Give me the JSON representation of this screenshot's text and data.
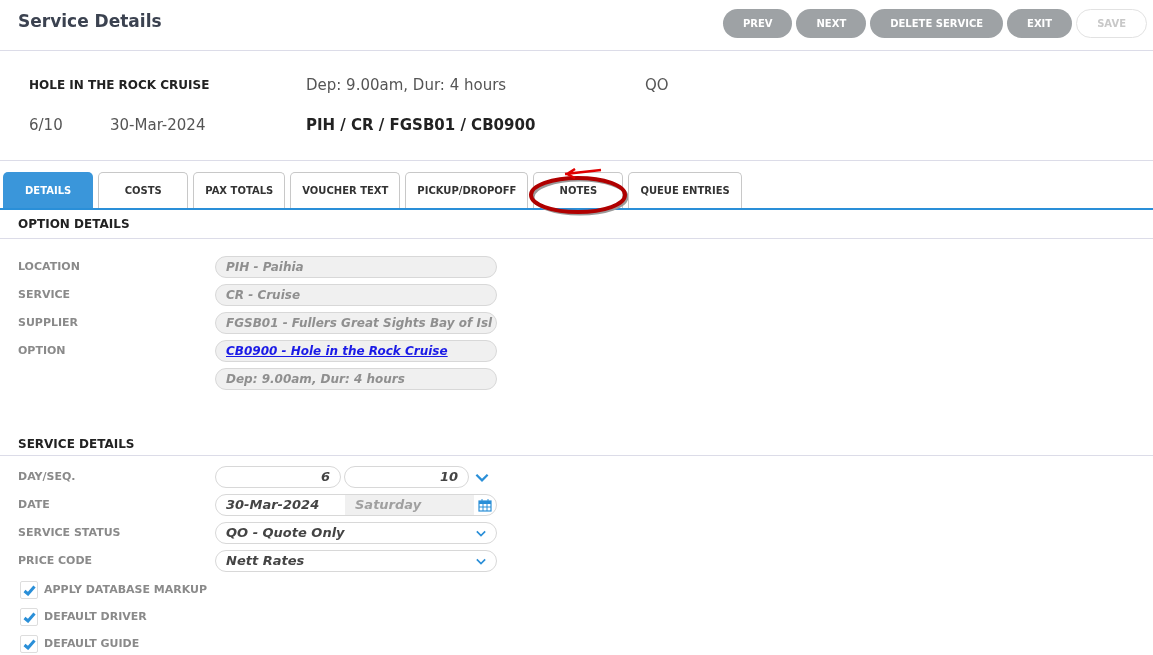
{
  "header": {
    "title": "Service Details",
    "buttons": [
      {
        "label": "PREV",
        "disabled": false
      },
      {
        "label": "NEXT",
        "disabled": false
      },
      {
        "label": "DELETE SERVICE",
        "disabled": false
      },
      {
        "label": "EXIT",
        "disabled": false
      },
      {
        "label": "SAVE",
        "disabled": true
      }
    ]
  },
  "summary": {
    "name": "HOLE IN THE ROCK CRUISE",
    "departure": "Dep: 9.00am, Dur: 4 hours",
    "status": "QO",
    "day_seq": "6/10",
    "date": "30-Mar-2024",
    "codes": "PIH / CR / FGSB01 / CB0900"
  },
  "tabs": [
    {
      "label": "DETAILS",
      "selected": true,
      "highlighted": false
    },
    {
      "label": "COSTS",
      "selected": false,
      "highlighted": false
    },
    {
      "label": "PAX TOTALS",
      "selected": false,
      "highlighted": false
    },
    {
      "label": "VOUCHER TEXT",
      "selected": false,
      "highlighted": false
    },
    {
      "label": "PICKUP/DROPOFF",
      "selected": false,
      "highlighted": false
    },
    {
      "label": "NOTES",
      "selected": false,
      "highlighted": true
    },
    {
      "label": "QUEUE ENTRIES",
      "selected": false,
      "highlighted": false
    }
  ],
  "option_details": {
    "heading": "OPTION DETAILS",
    "fields": [
      {
        "label": "LOCATION",
        "value": "PIH - Paihia",
        "kind": "text"
      },
      {
        "label": "SERVICE",
        "value": "CR - Cruise",
        "kind": "text"
      },
      {
        "label": "SUPPLIER",
        "value": "FGSB01 - Fullers Great Sights Bay of Isl",
        "kind": "text"
      },
      {
        "label": "OPTION",
        "value": "CB0900 - Hole in the Rock Cruise",
        "kind": "link"
      },
      {
        "value": "Dep: 9.00am, Dur: 4 hours",
        "kind": "text"
      }
    ]
  },
  "service_details": {
    "heading": "SERVICE DETAILS",
    "day_seq": {
      "label": "DAY/SEQ.",
      "day": "6",
      "seq": "10"
    },
    "date": {
      "label": "DATE",
      "value": "30-Mar-2024",
      "weekday": "Saturday"
    },
    "selects": [
      {
        "label": "SERVICE STATUS",
        "value": "QO - Quote Only"
      },
      {
        "label": "PRICE CODE",
        "value": "Nett Rates"
      }
    ],
    "checkboxes": [
      {
        "label": "APPLY DATABASE MARKUP",
        "checked": true
      },
      {
        "label": "DEFAULT DRIVER",
        "checked": true
      },
      {
        "label": "DEFAULT GUIDE",
        "checked": true
      }
    ]
  }
}
